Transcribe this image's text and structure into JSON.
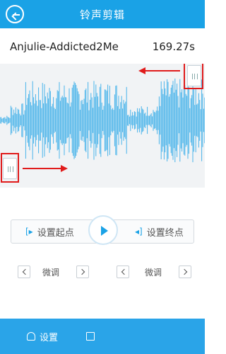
{
  "header": {
    "title": "铃声剪辑",
    "back_icon": "back-arrow-icon"
  },
  "track": {
    "name": "Anjulie-Addicted2Me",
    "duration": "169.27s"
  },
  "controls": {
    "set_start": "设置起点",
    "set_end": "设置终点",
    "play_icon": "play-icon"
  },
  "fine_tune": {
    "start_label": "微调",
    "end_label": "微调"
  },
  "bottom_bar": {
    "set_label": "设置",
    "save_icon": "save-icon"
  },
  "colors": {
    "accent": "#1aa2e6",
    "wave": "#4ab4ea",
    "marker": "#e01b1b"
  }
}
